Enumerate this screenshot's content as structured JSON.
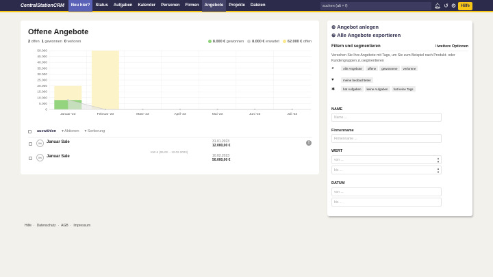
{
  "header": {
    "logo": "CentralStationCRM",
    "nav": [
      "Neu hier?",
      "Status",
      "Aufgaben",
      "Kalender",
      "Personen",
      "Firmen",
      "Angebote",
      "Projekte",
      "Dateien"
    ],
    "active": "Angebote",
    "search_placeholder": "suchen (alt + f)",
    "icons": [
      "bell-icon",
      "history-icon",
      "gear-icon"
    ],
    "help": "Hilfe"
  },
  "main": {
    "title": "Offene Angebote",
    "stats": [
      {
        "n": "2",
        "label": "offen"
      },
      {
        "n": "1",
        "label": "gewonnen"
      },
      {
        "n": "0",
        "label": "verloren"
      }
    ],
    "legend": [
      {
        "value": "8.000 €",
        "label": "gewonnen",
        "color": "#8fd27a"
      },
      {
        "value": "8.000 €",
        "label": "erwartet",
        "color": "#cfcfcf"
      },
      {
        "value": "62.000 €",
        "label": "offen",
        "color": "#fde98c"
      }
    ],
    "toolbar": {
      "select": "auswählen",
      "actions": "Aktionen",
      "sort": "Sortierung"
    },
    "rows": [
      {
        "pct": "0%",
        "name": "Januar Sale",
        "date": "31.01.2023",
        "value": "12.000,00 €"
      },
      {
        "pct": "0%",
        "name": "Januar Sale",
        "date": "10.02.2023",
        "value": "50.000,00 €"
      }
    ],
    "week_label": "KW 6 (06.02. - 12.02.2023)"
  },
  "chart_data": {
    "type": "bar",
    "categories": [
      "Januar '23",
      "Februar '23",
      "März '23",
      "April '23",
      "Mai '23",
      "Juni '23",
      "Juli '23"
    ],
    "ylim": [
      0,
      50000
    ],
    "yticks": [
      "0",
      "5.000",
      "10.000",
      "15.000",
      "20.000",
      "25.000",
      "30.000",
      "35.000",
      "40.000",
      "45.000",
      "50.000"
    ],
    "grid": true,
    "series": [
      {
        "name": "gewonnen",
        "color": "#95d47f",
        "values": [
          8000,
          0,
          0,
          0,
          0,
          0,
          0
        ]
      },
      {
        "name": "offen",
        "color": "#fdf3c8",
        "values": [
          12000,
          50000,
          0,
          0,
          0,
          0,
          0
        ]
      },
      {
        "name": "erwartet",
        "type": "line",
        "color": "#cccccc",
        "values": [
          8000,
          0,
          0,
          0,
          0,
          0,
          0
        ]
      }
    ]
  },
  "sidebar": {
    "create": "Angebot anlegen",
    "export": "Alle Angebote exportieren",
    "filter_title": "Filtern und segmentieren",
    "more": "weitere Optionen",
    "desc": "Versehen Sie Ihre Angebote mit Tags, um Sie zum Beispiel nach Produkt- oder Kundengruppen zu segmentieren",
    "tag_groups": [
      [
        "Alle Angebote",
        "offene",
        "gewonnene",
        "verlorene"
      ],
      [
        "meine beobachteten"
      ],
      [
        "hat Aufgaben",
        "keine Aufgaben",
        "hat keine Tags"
      ]
    ],
    "name_label": "NAME",
    "name_ph": "Name ...",
    "firm_label": "Firmenname",
    "firm_ph": "Firmenname ...",
    "wert_label": "WERT",
    "von_ph": "von ...",
    "bis_ph": "bis ...",
    "datum_label": "DATUM"
  },
  "footer": [
    "Hilfe",
    "Datenschutz",
    "AGB",
    "Impressum"
  ]
}
